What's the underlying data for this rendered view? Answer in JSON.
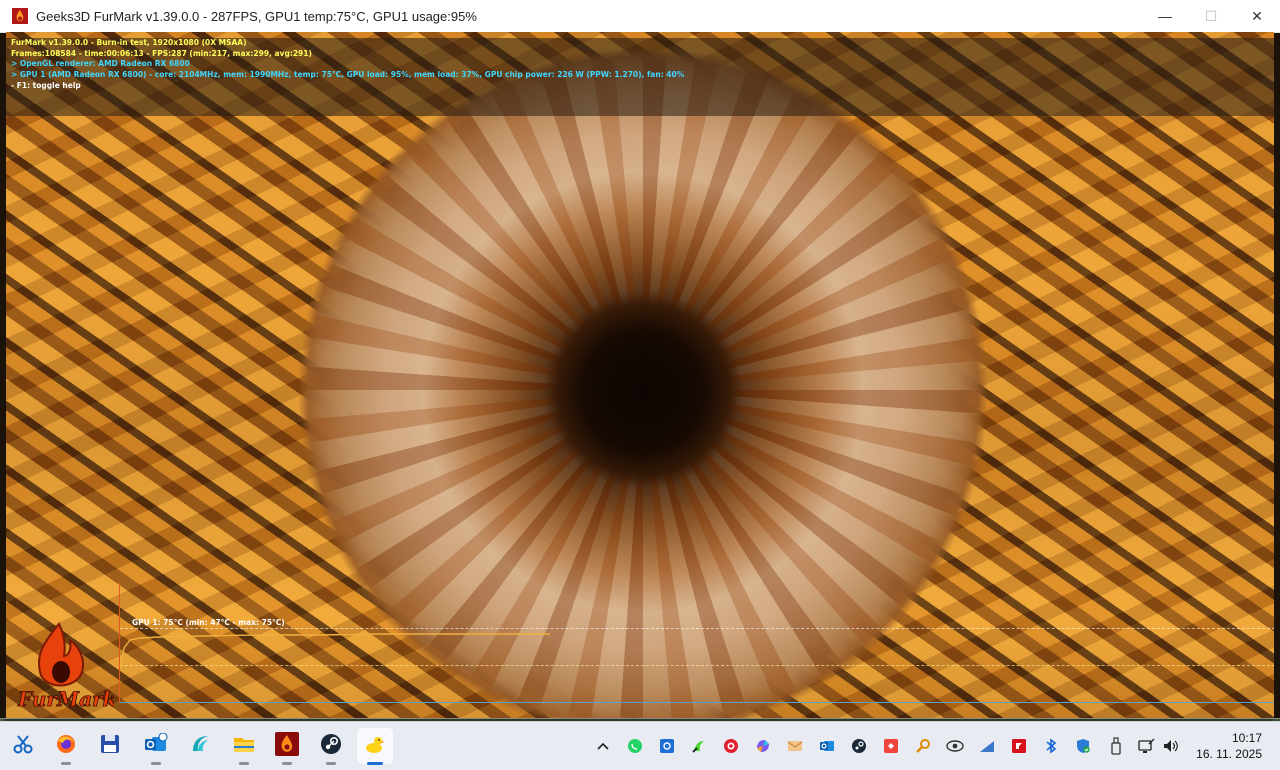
{
  "window": {
    "title": "Geeks3D FurMark v1.39.0.0 - 287FPS, GPU1 temp:75°C, GPU1 usage:95%",
    "minimize_glyph": "—",
    "maximize_glyph": "☐",
    "close_glyph": "✕"
  },
  "hud": {
    "line1": "FurMark v1.39.0.0 - Burn-in test, 1920x1080 (0X MSAA)",
    "line2": "Frames:108584 - time:00:06:13 - FPS:287 (min:217, max:299, avg:291)",
    "line3": "> OpenGL renderer: AMD Radeon RX 6800",
    "line4": "> GPU 1 (AMD Radeon RX 6800) - core: 2104MHz, mem: 1990MHz, temp: 75°C, GPU load: 95%, mem load: 37%, GPU chip power: 226 W (PPW: 1.270), fan: 40%",
    "line5": "- F1: toggle help"
  },
  "graph": {
    "label": "GPU 1: 75°C (min: 47°C - max: 75°C)",
    "current_temp_c": 75,
    "min_temp_c": 47,
    "max_temp_c": 75
  },
  "logo": {
    "text": "FurMark"
  },
  "taskbar": {
    "apps": [
      {
        "name": "snipping-tool-icon",
        "active": false,
        "dot": false
      },
      {
        "name": "firefox-icon",
        "active": false,
        "dot": true
      },
      {
        "name": "save-floppy-icon",
        "active": false,
        "dot": false
      },
      {
        "name": "outlook-icon",
        "active": false,
        "dot": true
      },
      {
        "name": "browser-wave-icon",
        "active": false,
        "dot": false
      },
      {
        "name": "file-explorer-icon",
        "active": false,
        "dot": true
      },
      {
        "name": "furmark-icon",
        "active": false,
        "dot": true
      },
      {
        "name": "steam-icon",
        "active": false,
        "dot": true
      },
      {
        "name": "duck-app-icon",
        "active": true,
        "dot": true
      }
    ],
    "tray": [
      "chevron-up-icon",
      "whatsapp-icon",
      "settings-app-icon",
      "razer-icon",
      "cursor-app-icon",
      "copilot-icon",
      "mail-icon",
      "outlook-tray-icon",
      "steam-tray-icon",
      "anydesk-icon",
      "search-key-icon",
      "nvidia-eye-icon",
      "network-bars-icon",
      "amd-icon",
      "bluetooth-icon",
      "security-shield-icon",
      "usb-drive-icon",
      "wifi-icon",
      "volume-icon"
    ],
    "time": "10:17",
    "date": "16. 11. 2025"
  }
}
